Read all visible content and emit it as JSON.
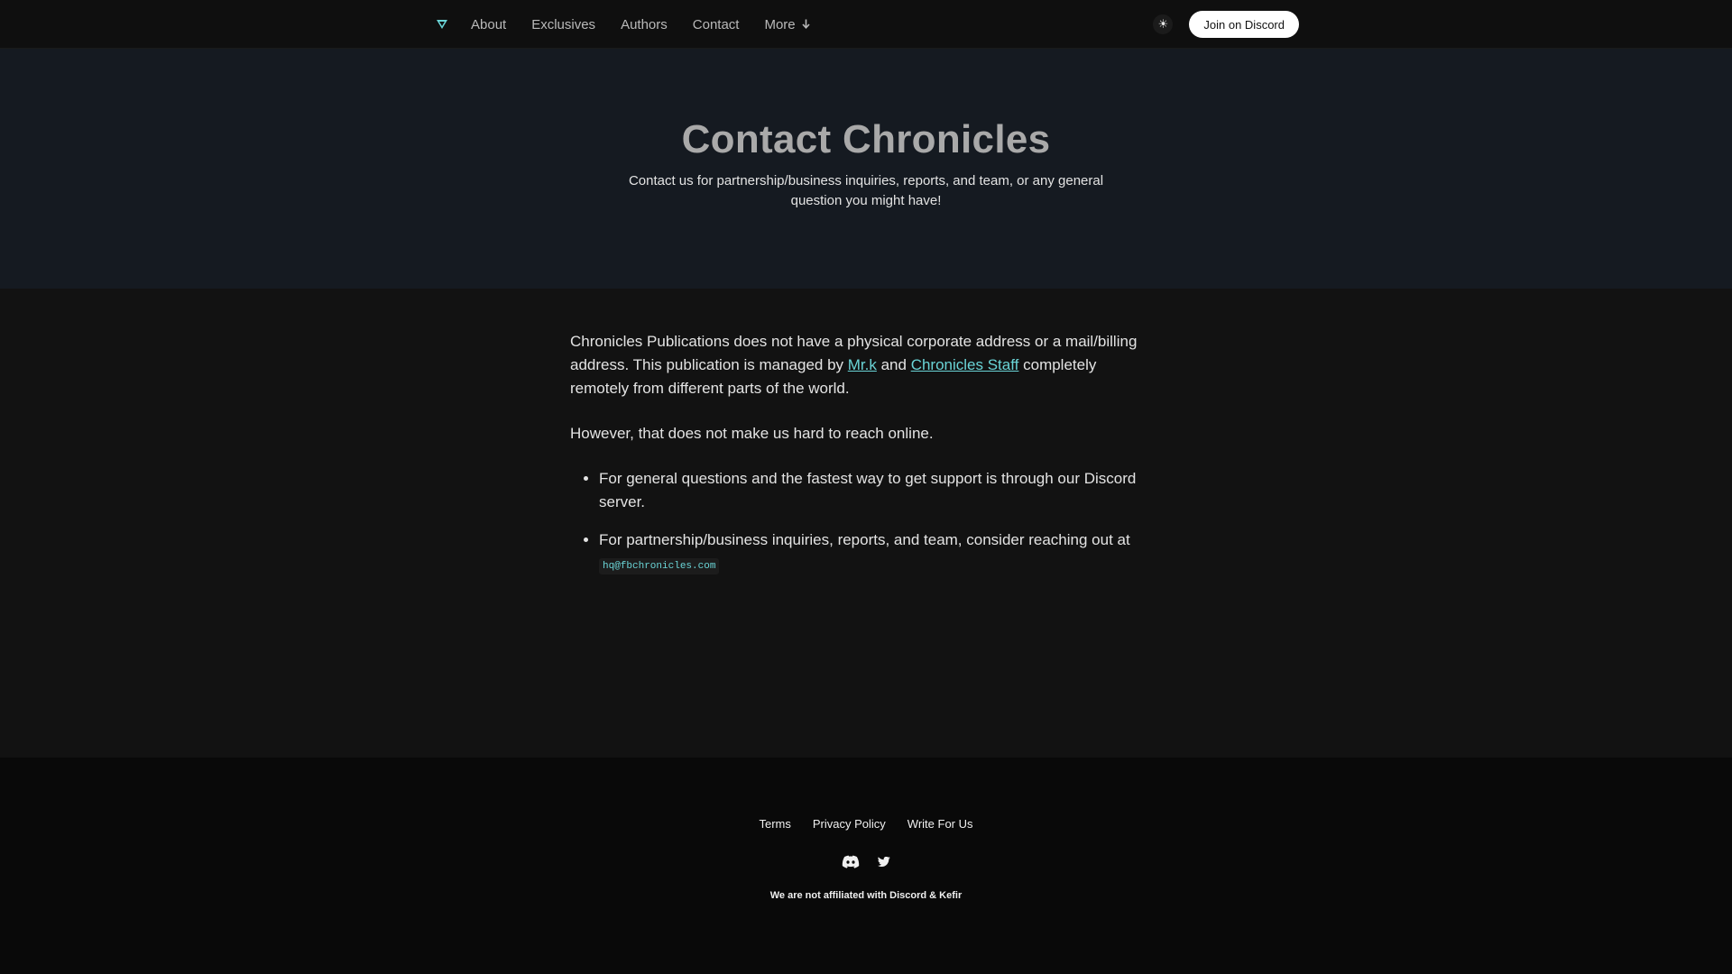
{
  "nav": {
    "logo_icon": "chronicles-logo-icon",
    "links": [
      {
        "label": "About"
      },
      {
        "label": "Exclusives"
      },
      {
        "label": "Authors"
      },
      {
        "label": "Contact"
      }
    ],
    "more_label": "More",
    "more_icon": "arrow-down-icon",
    "theme_icon": "sun-icon",
    "theme_glyph": "☀",
    "cta_label": "Join on Discord"
  },
  "hero": {
    "title": "Contact Chronicles",
    "subtitle": "Contact us for partnership/business inquiries, reports, and team, or any general question you might have!"
  },
  "content": {
    "p1_before": "Chronicles Publications does not have a physical corporate address or a mail/billing address. This publication is managed by ",
    "p1_link1": "Mr.k",
    "p1_mid": " and ",
    "p1_link2": "Chronicles Staff",
    "p1_after": " completely remotely from different parts of the world.",
    "p2": "However, that does not make us hard to reach online.",
    "bullets": [
      {
        "text": "For general questions and the fastest way to get support is through our Discord server."
      },
      {
        "text": "For partnership/business inquiries, reports, and team, consider reaching out at ",
        "code": "hq@fbchronicles.com"
      }
    ]
  },
  "footer": {
    "links": [
      {
        "label": "Terms"
      },
      {
        "label": "Privacy Policy"
      },
      {
        "label": "Write For Us"
      }
    ],
    "social_icons": [
      "discord-icon",
      "twitter-icon"
    ],
    "note": "We are not affiliated with Discord & Kefir"
  },
  "colors": {
    "accent": "#6ad4d6",
    "nav_bg": "#0f0f0f",
    "hero_bg": "#151a21",
    "body_bg": "#121212",
    "footer_bg": "#090909"
  }
}
